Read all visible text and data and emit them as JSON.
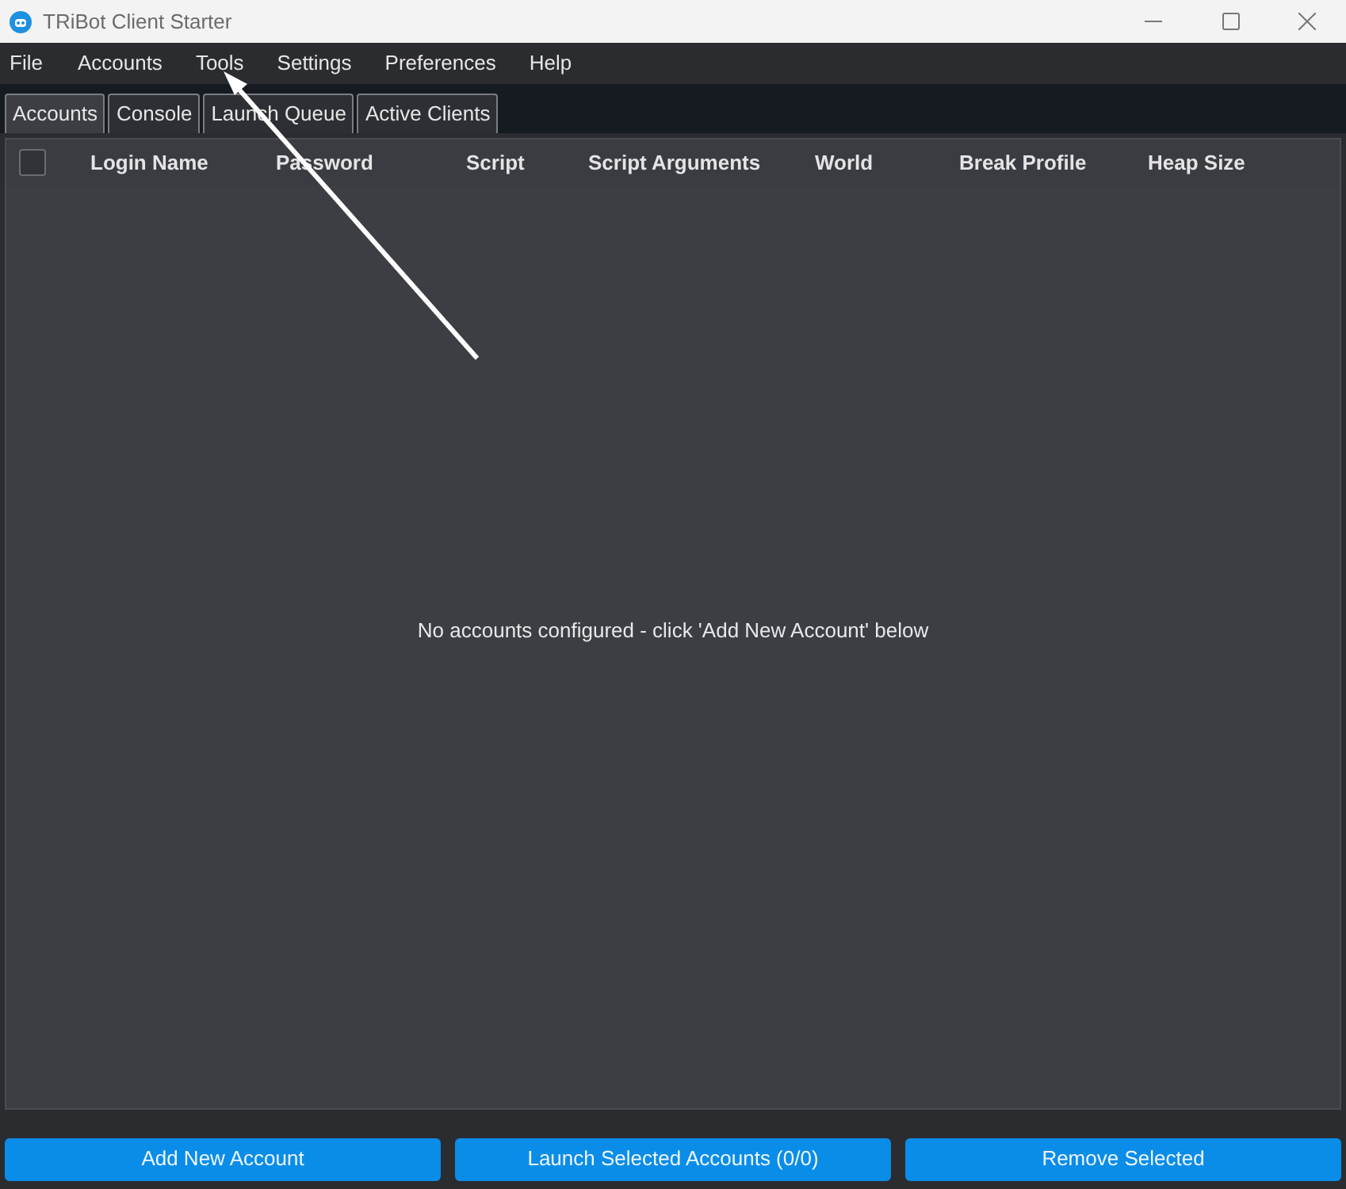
{
  "window": {
    "title": "TRiBot Client Starter"
  },
  "menu": [
    "File",
    "Accounts",
    "Tools",
    "Settings",
    "Preferences",
    "Help"
  ],
  "tabs": [
    {
      "label": "Accounts",
      "selected": true
    },
    {
      "label": "Console",
      "selected": false
    },
    {
      "label": "Launch Queue",
      "selected": false
    },
    {
      "label": "Active Clients",
      "selected": false
    }
  ],
  "table": {
    "select_all_checked": false,
    "columns": [
      "Login Name",
      "Password",
      "Script",
      "Script Arguments",
      "World",
      "Break Profile",
      "Heap Size"
    ],
    "empty_message": "No accounts configured - click 'Add New Account' below"
  },
  "buttons": [
    "Add New Account",
    "Launch Selected Accounts (0/0)",
    "Remove Selected"
  ]
}
